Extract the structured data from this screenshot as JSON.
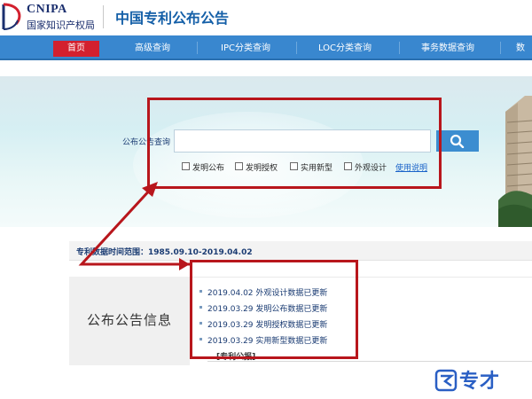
{
  "header": {
    "logo_en": "CNIPA",
    "logo_cn": "国家知识产权局",
    "site_title": "中国专利公布公告"
  },
  "nav": {
    "items": [
      "首页",
      "高级查询",
      "IPC分类查询",
      "LOC分类查询",
      "事务数据查询",
      "数"
    ],
    "active": "首页"
  },
  "search": {
    "label": "公布公告查询",
    "value": "",
    "placeholder": "",
    "filters": [
      "发明公布",
      "发明授权",
      "实用新型",
      "外观设计"
    ],
    "help_link": "使用说明"
  },
  "date_range": "专利数据时间范围：1985.09.10-2019.04.02",
  "info": {
    "title": "公布公告信息",
    "updates": [
      "2019.04.02 外观设计数据已更新",
      "2019.03.29 发明公布数据已更新",
      "2019.03.29 发明授权数据已更新",
      "2019.03.29 实用新型数据已更新"
    ],
    "patent_heading": "[专利公报]"
  },
  "watermark": "专才",
  "colors": {
    "brand_blue": "#1560a8",
    "nav_blue": "#3987cf",
    "active_red": "#d3202e",
    "annotation_red": "#b8161c"
  }
}
